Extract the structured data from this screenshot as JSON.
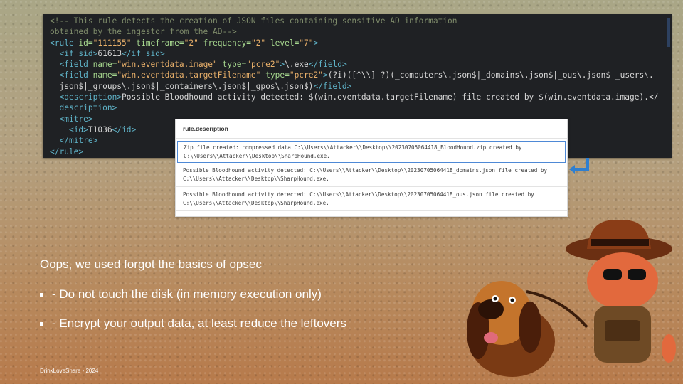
{
  "code": {
    "lines": [
      [
        {
          "c": "c-com",
          "t": "<!-- This rule detects the creation of JSON files containing sensitive AD information"
        }
      ],
      [
        {
          "c": "c-com",
          "t": "obtained by the ingestor from the AD-->"
        }
      ],
      [
        {
          "c": "c-tag",
          "t": "<rule "
        },
        {
          "c": "c-attr",
          "t": "id="
        },
        {
          "c": "c-val",
          "t": "\"111155\""
        },
        {
          "c": "c-attr",
          "t": " timeframe="
        },
        {
          "c": "c-val",
          "t": "\"2\""
        },
        {
          "c": "c-attr",
          "t": " frequency="
        },
        {
          "c": "c-val",
          "t": "\"2\""
        },
        {
          "c": "c-attr",
          "t": " level="
        },
        {
          "c": "c-val",
          "t": "\"7\""
        },
        {
          "c": "c-tag",
          "t": ">"
        }
      ],
      [
        {
          "c": "c-text",
          "t": "  "
        },
        {
          "c": "c-tag",
          "t": "<if_sid>"
        },
        {
          "c": "c-text",
          "t": "61613"
        },
        {
          "c": "c-tag",
          "t": "</if_sid>"
        }
      ],
      [
        {
          "c": "c-text",
          "t": "  "
        },
        {
          "c": "c-tag",
          "t": "<field "
        },
        {
          "c": "c-attr",
          "t": "name="
        },
        {
          "c": "c-val",
          "t": "\"win.eventdata.image\""
        },
        {
          "c": "c-attr",
          "t": " type="
        },
        {
          "c": "c-val",
          "t": "\"pcre2\""
        },
        {
          "c": "c-tag",
          "t": ">"
        },
        {
          "c": "c-text",
          "t": "\\.exe"
        },
        {
          "c": "c-tag",
          "t": "</field>"
        }
      ],
      [
        {
          "c": "c-text",
          "t": "  "
        },
        {
          "c": "c-tag",
          "t": "<field "
        },
        {
          "c": "c-attr",
          "t": "name="
        },
        {
          "c": "c-val",
          "t": "\"win.eventdata.targetFilename\""
        },
        {
          "c": "c-attr",
          "t": " type="
        },
        {
          "c": "c-val",
          "t": "\"pcre2\""
        },
        {
          "c": "c-tag",
          "t": ">"
        },
        {
          "c": "c-text",
          "t": "(?i)([^\\\\]+?)(_computers\\.json$|_domains\\.json$|_ous\\.json$|_users\\."
        }
      ],
      [
        {
          "c": "c-text",
          "t": "  json$|_groups\\.json$|_containers\\.json$|_gpos\\.json$)"
        },
        {
          "c": "c-tag",
          "t": "</field>"
        }
      ],
      [
        {
          "c": "c-text",
          "t": "  "
        },
        {
          "c": "c-tag",
          "t": "<description>"
        },
        {
          "c": "c-text",
          "t": "Possible Bloodhound activity detected: $(win.eventdata.targetFilename) file created by $(win.eventdata.image).</"
        }
      ],
      [
        {
          "c": "c-tag",
          "t": "  description>"
        }
      ],
      [
        {
          "c": "c-text",
          "t": "  "
        },
        {
          "c": "c-tag",
          "t": "<mitre>"
        }
      ],
      [
        {
          "c": "c-text",
          "t": "    "
        },
        {
          "c": "c-tag",
          "t": "<id>"
        },
        {
          "c": "c-text",
          "t": "T1036"
        },
        {
          "c": "c-tag",
          "t": "</id>"
        }
      ],
      [
        {
          "c": "c-text",
          "t": "  "
        },
        {
          "c": "c-tag",
          "t": "</mitre>"
        }
      ],
      [
        {
          "c": "c-tag",
          "t": "</rule>"
        }
      ]
    ]
  },
  "results": {
    "header": "rule.description",
    "rows": [
      "Zip file created: compressed data C:\\\\Users\\\\Attacker\\\\Desktop\\\\20230705064418_BloodHound.zip created by C:\\\\Users\\\\Attacker\\\\Desktop\\\\SharpHound.exe.",
      "Possible Bloodhound activity detected: C:\\\\Users\\\\Attacker\\\\Desktop\\\\20230705064418_domains.json file created by C:\\\\Users\\\\Attacker\\\\Desktop\\\\SharpHound.exe.",
      "Possible Bloodhound activity detected: C:\\\\Users\\\\Attacker\\\\Desktop\\\\20230705064418_ous.json file created by C:\\\\Users\\\\Attacker\\\\Desktop\\\\SharpHound.exe."
    ]
  },
  "slide": {
    "heading": "Oops, we used forgot the basics of opsec",
    "bullets": [
      "- Do not touch the disk (in memory execution only)",
      "- Encrypt your output data, at least reduce the leftovers"
    ],
    "footer": "DrinkLoveShare - 2024"
  },
  "colors": {
    "accent_arrow": "#2f7fd0",
    "code_bg": "#1f2124"
  }
}
